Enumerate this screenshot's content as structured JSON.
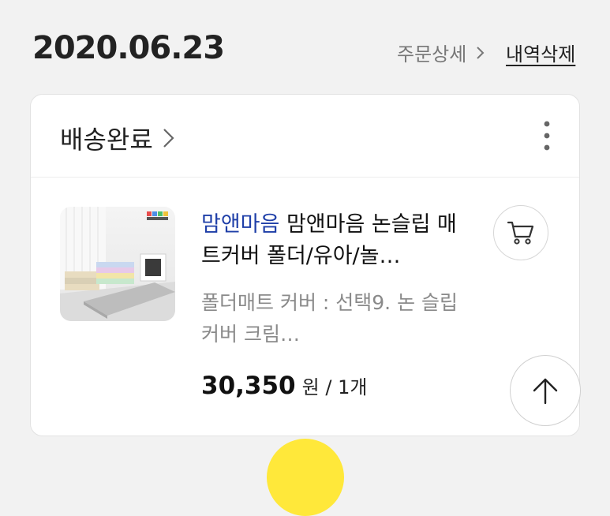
{
  "header": {
    "order_date": "2020.06.23",
    "order_detail_label": "주문상세",
    "delete_history_label": "내역삭제"
  },
  "order": {
    "status_label": "배송완료",
    "product": {
      "brand": "맘앤마음",
      "title": "맘앤마음 논슬립 매트커버 폴더/유아/놀…",
      "option": "폴더매트 커버 : 선택9. 논 슬립 커버 크림…",
      "price": "30,350",
      "price_suffix": "원 / 1개"
    }
  },
  "icons": {
    "more": "more-vertical-icon",
    "cart": "cart-icon",
    "scroll_top": "arrow-up-icon",
    "chevron": "chevron-right-icon"
  },
  "colors": {
    "brand_link": "#1f3fa8",
    "background": "#f2f2f2",
    "accent_blob": "#ffe83a"
  }
}
